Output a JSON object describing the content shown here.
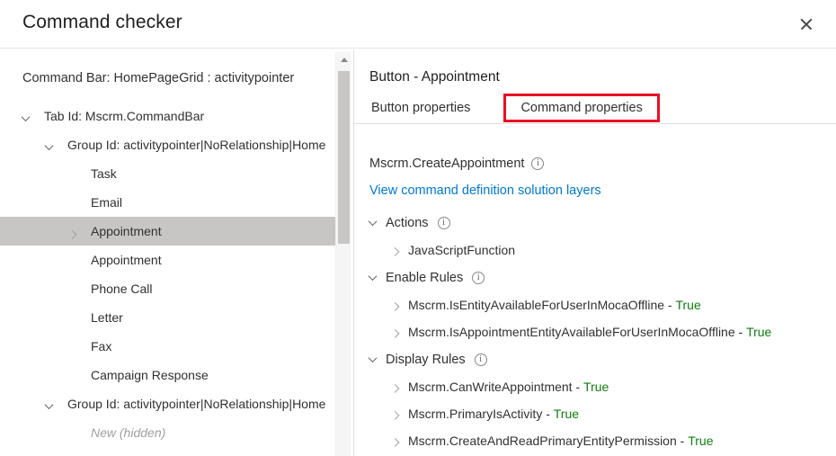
{
  "window": {
    "title": "Command checker",
    "close_icon": "close-icon"
  },
  "left_panel": {
    "caption": "Command Bar: HomePageGrid : activitypointer",
    "scrollbar": {
      "up_arrow_icon": "scroll-up-arrow-icon",
      "thumb_name": "scrollbar-thumb"
    },
    "tree": [
      {
        "label": "Tab Id: Mscrm.CommandBar",
        "indent": 0,
        "twisty": "chevron-down-icon",
        "selected": false,
        "hidden": false
      },
      {
        "label": "Group Id: activitypointer|NoRelationship|Home",
        "indent": 1,
        "twisty": "chevron-down-icon",
        "selected": false,
        "hidden": false
      },
      {
        "label": "Task",
        "indent": 2,
        "twisty": "none",
        "selected": false,
        "hidden": false
      },
      {
        "label": "Email",
        "indent": 2,
        "twisty": "none",
        "selected": false,
        "hidden": false
      },
      {
        "label": "Appointment",
        "indent": 2,
        "twisty": "chevron-right-icon",
        "selected": true,
        "hidden": false
      },
      {
        "label": "Appointment",
        "indent": 2,
        "twisty": "none",
        "selected": false,
        "hidden": false
      },
      {
        "label": "Phone Call",
        "indent": 2,
        "twisty": "none",
        "selected": false,
        "hidden": false
      },
      {
        "label": "Letter",
        "indent": 2,
        "twisty": "none",
        "selected": false,
        "hidden": false
      },
      {
        "label": "Fax",
        "indent": 2,
        "twisty": "none",
        "selected": false,
        "hidden": false
      },
      {
        "label": "Campaign Response",
        "indent": 2,
        "twisty": "none",
        "selected": false,
        "hidden": false
      },
      {
        "label": "Group Id: activitypointer|NoRelationship|Home",
        "indent": 1,
        "twisty": "chevron-down-icon",
        "selected": false,
        "hidden": false
      },
      {
        "label": "New (hidden)",
        "indent": 2,
        "twisty": "none",
        "selected": false,
        "hidden": true
      }
    ]
  },
  "right_panel": {
    "title": "Button - Appointment",
    "tabs": [
      {
        "label": "Button properties",
        "active": false,
        "highlighted": false
      },
      {
        "label": "Command properties",
        "active": true,
        "highlighted": true
      }
    ],
    "command_name": "Mscrm.CreateAppointment",
    "command_info_icon": "info-icon",
    "solution_link": "View command definition solution layers",
    "sections": [
      {
        "title": "Actions",
        "twisty": "chevron-down-icon",
        "info_icon": "info-icon",
        "rows": [
          {
            "label": "JavaScriptFunction",
            "value": "",
            "twisty": "chevron-right-icon"
          }
        ]
      },
      {
        "title": "Enable Rules",
        "twisty": "chevron-down-icon",
        "info_icon": "info-icon",
        "rows": [
          {
            "label": "Mscrm.IsEntityAvailableForUserInMocaOffline",
            "value": "True",
            "twisty": "chevron-right-icon"
          },
          {
            "label": "Mscrm.IsAppointmentEntityAvailableForUserInMocaOffline",
            "value": "True",
            "twisty": "chevron-right-icon"
          }
        ]
      },
      {
        "title": "Display Rules",
        "twisty": "chevron-down-icon",
        "info_icon": "info-icon",
        "rows": [
          {
            "label": "Mscrm.CanWriteAppointment",
            "value": "True",
            "twisty": "chevron-right-icon"
          },
          {
            "label": "Mscrm.PrimaryIsActivity",
            "value": "True",
            "twisty": "chevron-right-icon"
          },
          {
            "label": "Mscrm.CreateAndReadPrimaryEntityPermission",
            "value": "True",
            "twisty": "chevron-right-icon"
          }
        ]
      }
    ]
  },
  "colors": {
    "accent_link": "#0078D4",
    "true_green": "#107C10",
    "highlight_red": "#E81123",
    "selected_row": "#C8C6C4"
  }
}
